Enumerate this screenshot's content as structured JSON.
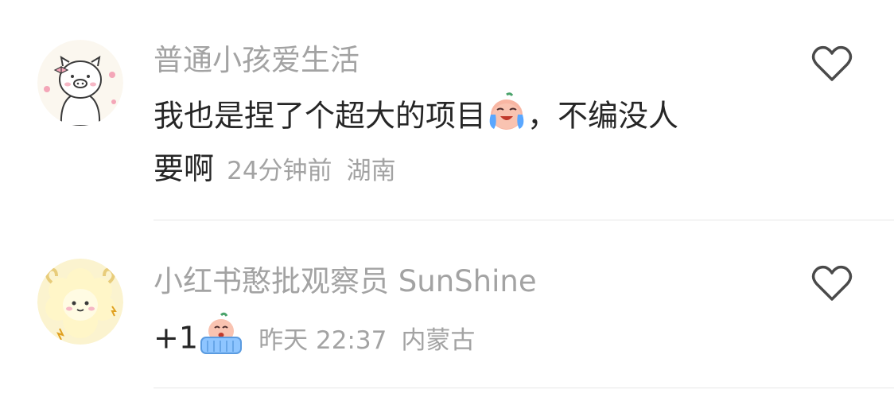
{
  "comments": [
    {
      "username": "普通小孩爱生活",
      "text_part1": "我也是捏了个超大的项目",
      "text_part2": "，不编没人",
      "text_line2": "要啊",
      "time": "24分钟前",
      "location": "湖南",
      "emoji": "crying-face-emoji",
      "avatar": "pig-avatar",
      "like_icon": "heart-outline-icon"
    },
    {
      "username": "小红书憨批观察员 SunShine",
      "text": "+1",
      "time": "昨天 22:37",
      "location": "内蒙古",
      "emoji": "crying-blanket-emoji",
      "avatar": "sheep-avatar",
      "like_icon": "heart-outline-icon"
    }
  ],
  "colors": {
    "text": "#262626",
    "secondary": "#a3a3a3",
    "divider": "#e6e6e6"
  }
}
